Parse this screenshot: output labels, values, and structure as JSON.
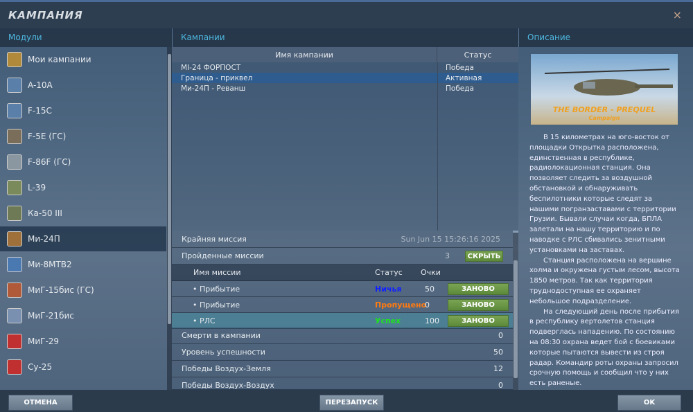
{
  "window": {
    "title": "КАМПАНИЯ",
    "close": "×"
  },
  "headers": {
    "modules": "Модули",
    "campaigns": "Кампании",
    "description": "Описание"
  },
  "modules": [
    {
      "label": "Мои кампании",
      "icon": "folder-icon",
      "color": "#b08a3a"
    },
    {
      "label": "A-10A",
      "icon": "a10a-badge-icon",
      "color": "#5a7fa8"
    },
    {
      "label": "F-15C",
      "icon": "f15c-badge-icon",
      "color": "#5a7fa8"
    },
    {
      "label": "F-5E (ГС)",
      "icon": "f5e-icon",
      "color": "#7a6e5a"
    },
    {
      "label": "F-86F (ГС)",
      "icon": "f86f-icon",
      "color": "#8a96a0"
    },
    {
      "label": "L-39",
      "icon": "l39-icon",
      "color": "#7a8a5a"
    },
    {
      "label": "Ка-50 III",
      "icon": "ka50-icon",
      "color": "#6e7a55"
    },
    {
      "label": "Ми-24П",
      "icon": "mi24p-icon",
      "color": "#a0703a"
    },
    {
      "label": "Ми-8МТВ2",
      "icon": "mi8-icon",
      "color": "#4a78b0"
    },
    {
      "label": "МиГ-15бис (ГС)",
      "icon": "mig15-icon",
      "color": "#b05a3a"
    },
    {
      "label": "МиГ-21бис",
      "icon": "mig21-icon",
      "color": "#7a90b0"
    },
    {
      "label": "МиГ-29",
      "icon": "mig29-badge-icon",
      "color": "#c03030"
    },
    {
      "label": "Су-25",
      "icon": "su25-badge-icon",
      "color": "#c03030"
    }
  ],
  "selected_module": 7,
  "campaign_table": {
    "col_name": "Имя кампании",
    "col_status": "Статус",
    "rows": [
      {
        "name": "MI-24 ФОРПОСТ",
        "status": "Победа"
      },
      {
        "name": "Граница - приквел",
        "status": "Активная"
      },
      {
        "name": "Ми-24П - Реванш",
        "status": "Победа"
      }
    ],
    "selected": 1
  },
  "stats": {
    "last_mission_label": "Крайняя миссия",
    "last_mission_value": "Sun Jun 15 15:26:16 2025",
    "passed_label": "Пройденные миссии",
    "passed_value": "3",
    "hide_button": "СКРЫТЬ",
    "mission_cols": {
      "name": "Имя миссии",
      "status": "Статус",
      "points": "Очки"
    },
    "missions": [
      {
        "name": "• Прибытие",
        "status": "Ничья",
        "status_color": "#1020ff",
        "points": "50",
        "button": "ЗАНОВО"
      },
      {
        "name": "• Прибытие",
        "status": "Пропущено",
        "status_color": "#ff7a10",
        "points": "0",
        "button": "ЗАНОВО"
      },
      {
        "name": "• РЛС",
        "status": "Успех",
        "status_color": "#20e020",
        "points": "100",
        "button": "ЗАНОВО"
      }
    ],
    "deaths_label": "Смерти в кампании",
    "deaths_value": "0",
    "success_label": "Уровень успешности",
    "success_value": "50",
    "ag_label": "Победы Воздух-Земля",
    "ag_value": "12",
    "aa_label": "Победы Воздух-Воздух",
    "aa_value": "0"
  },
  "description": {
    "banner_title": "THE BORDER - PREQUEL",
    "banner_sub": "Campaign",
    "paragraphs": [
      "В 15 километрах на юго-восток от площадки Открытка расположена, единственная в республике, радиолокационная станция. Она позволяет следить за воздушной обстановкой и обнаруживать беспилотники которые следят за нашими погранзаставами с территории Грузии. Бывали случаи когда, БПЛА залетали на нашу территорию и по наводке с РЛС сбивались зенитными установками на заставах.",
      "Станция расположена на вершине холма и окружена густым лесом, высота 1850 метров. Так как территория труднодоступная ее охраняет небольшое подразделение.",
      "На следующий день после прибытия в республику вертолетов станция подверглась нападению. По состоянию на 08:30 охрана ведет бой с боевиками которые пытаются вывести из строя радар. Командир роты охраны запросил срочную помощь и сообщил что у них есть раненые."
    ]
  },
  "footer": {
    "cancel": "ОТМЕНА",
    "restart": "ПЕРЕЗАПУСК",
    "ok": "OK"
  }
}
